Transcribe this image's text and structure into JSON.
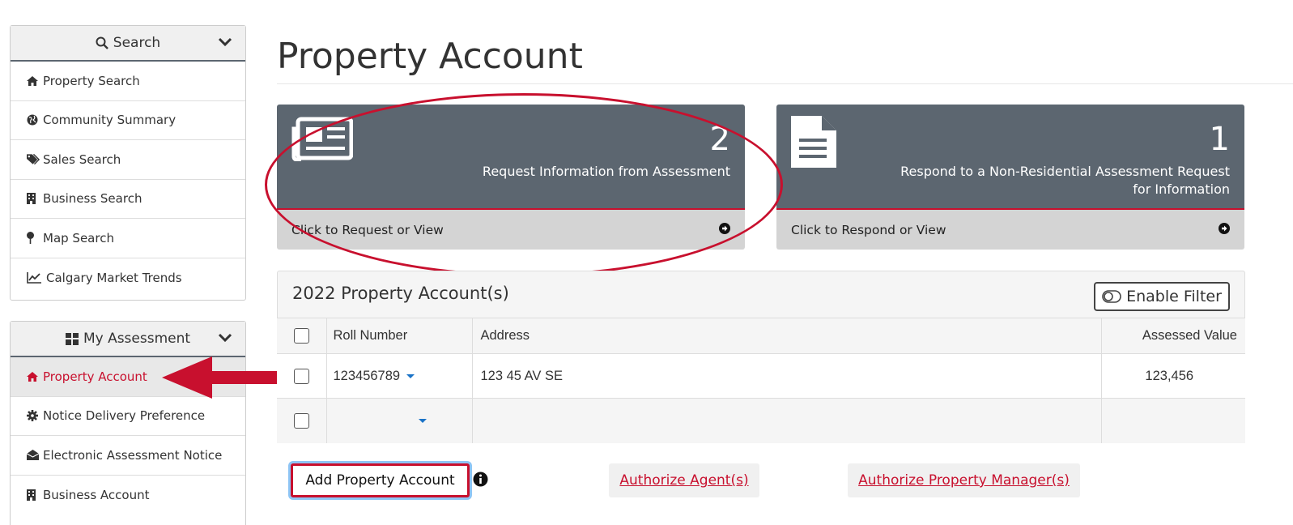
{
  "sidebar": {
    "search_panel": {
      "title": "Search",
      "items": [
        {
          "label": "Property Search",
          "icon": "home-icon"
        },
        {
          "label": "Community Summary",
          "icon": "globe-icon"
        },
        {
          "label": "Sales Search",
          "icon": "tags-icon"
        },
        {
          "label": "Business Search",
          "icon": "building-icon"
        },
        {
          "label": "Map Search",
          "icon": "map-pin-icon"
        },
        {
          "label": "Calgary Market Trends",
          "icon": "line-chart-icon"
        }
      ]
    },
    "assessment_panel": {
      "title": "My Assessment",
      "items": [
        {
          "label": "Property Account",
          "icon": "home-icon",
          "active": true
        },
        {
          "label": "Notice Delivery Preference",
          "icon": "gear-icon"
        },
        {
          "label": "Electronic Assessment Notice",
          "icon": "envelope-open-icon"
        },
        {
          "label": "Business Account",
          "icon": "building-icon"
        }
      ]
    }
  },
  "main": {
    "title": "Property Account",
    "cards": [
      {
        "count": "2",
        "label": "Request Information from Assessment",
        "footer": "Click to Request or View",
        "icon": "newspaper-icon"
      },
      {
        "count": "1",
        "label": "Respond to a Non-Residential Assessment Request for Information",
        "footer": "Click to Respond or View",
        "icon": "file-text-icon"
      }
    ],
    "accounts": {
      "title": "2022 Property Account(s)",
      "filter_label": "Enable Filter",
      "columns": {
        "roll": "Roll Number",
        "address": "Address",
        "value": "Assessed Value"
      },
      "rows": [
        {
          "roll": "123456789",
          "address": "123 45 AV SE",
          "value": "123,456"
        },
        {
          "roll": "",
          "address": "",
          "value": ""
        }
      ]
    },
    "actions": {
      "add_label": "Add Property Account",
      "agent_label": "Authorize Agent(s)",
      "manager_label": "Authorize Property Manager(s)"
    }
  },
  "colors": {
    "brand_red": "#c8102e",
    "card_bg": "#5c6670",
    "card_footer_bg": "#d4d4d4",
    "link_blue": "#1a73c7"
  }
}
